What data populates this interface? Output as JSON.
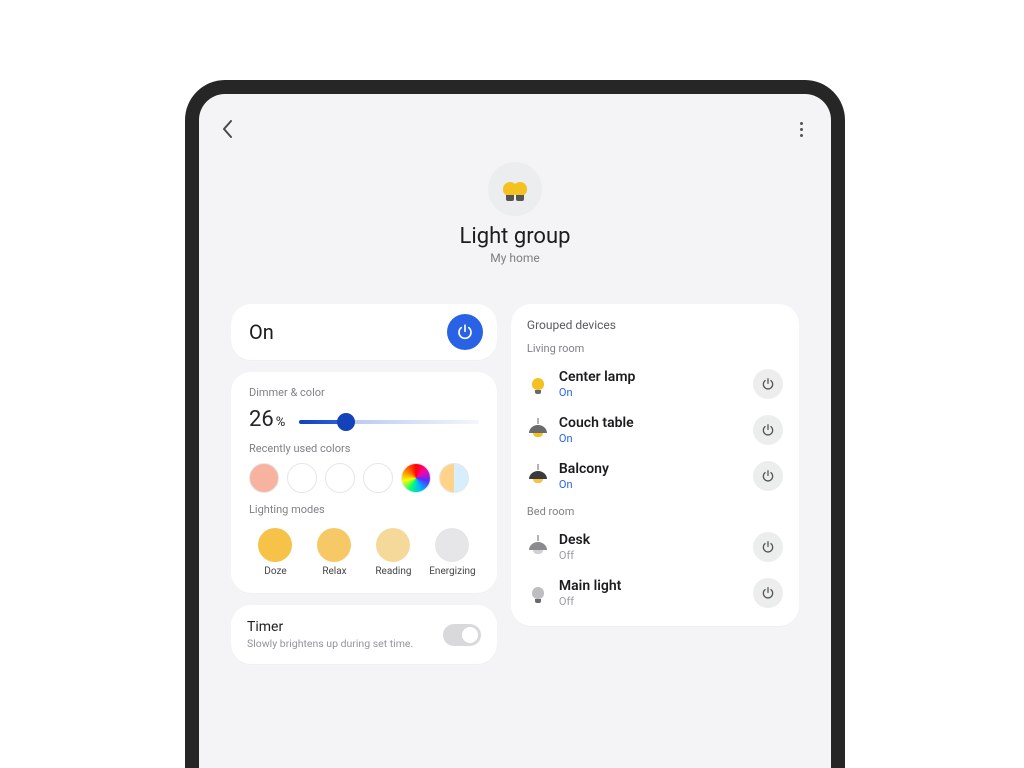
{
  "header": {
    "title": "Light group",
    "subtitle": "My home"
  },
  "power": {
    "state_label": "On"
  },
  "dimmer": {
    "section_label": "Dimmer & color",
    "value": "26",
    "unit": "%",
    "percent": 26
  },
  "recent_colors": {
    "label": "Recently used colors",
    "swatches": [
      {
        "id": "peach",
        "style": "background:#f8b3a0;"
      },
      {
        "id": "empty1",
        "style": "background:#ffffff;"
      },
      {
        "id": "empty2",
        "style": "background:#ffffff;"
      },
      {
        "id": "empty3",
        "style": "background:#ffffff;"
      },
      {
        "id": "rainbow",
        "style": "background: conic-gradient(red, #ff00a8, #5b2bff, #00b3ff, #00ff7a, #f6ff00, #ff7a00, red);"
      },
      {
        "id": "warmcool",
        "style": "background: linear-gradient(to right, #ffd48a 0 50%, #d7eeff 50% 100%);"
      }
    ]
  },
  "modes": {
    "label": "Lighting modes",
    "items": [
      {
        "name": "Doze",
        "color": "#f6c247"
      },
      {
        "name": "Relax",
        "color": "#f6c966"
      },
      {
        "name": "Reading",
        "color": "#f5d99b"
      },
      {
        "name": "Energizing",
        "color": "#e6e6e9"
      }
    ]
  },
  "timer": {
    "title": "Timer",
    "subtitle": "Slowly brightens up during set time.",
    "enabled": false
  },
  "devices": {
    "header": "Grouped devices",
    "rooms": [
      {
        "name": "Living room",
        "items": [
          {
            "name": "Center lamp",
            "state": "On",
            "on": true,
            "icon": "bulb-on"
          },
          {
            "name": "Couch table",
            "state": "On",
            "on": true,
            "icon": "pendant-on"
          },
          {
            "name": "Balcony",
            "state": "On",
            "on": true,
            "icon": "pendant-warm"
          }
        ]
      },
      {
        "name": "Bed room",
        "items": [
          {
            "name": "Desk",
            "state": "Off",
            "on": false,
            "icon": "pendant-off"
          },
          {
            "name": "Main light",
            "state": "Off",
            "on": false,
            "icon": "bulb-off"
          }
        ]
      }
    ]
  }
}
